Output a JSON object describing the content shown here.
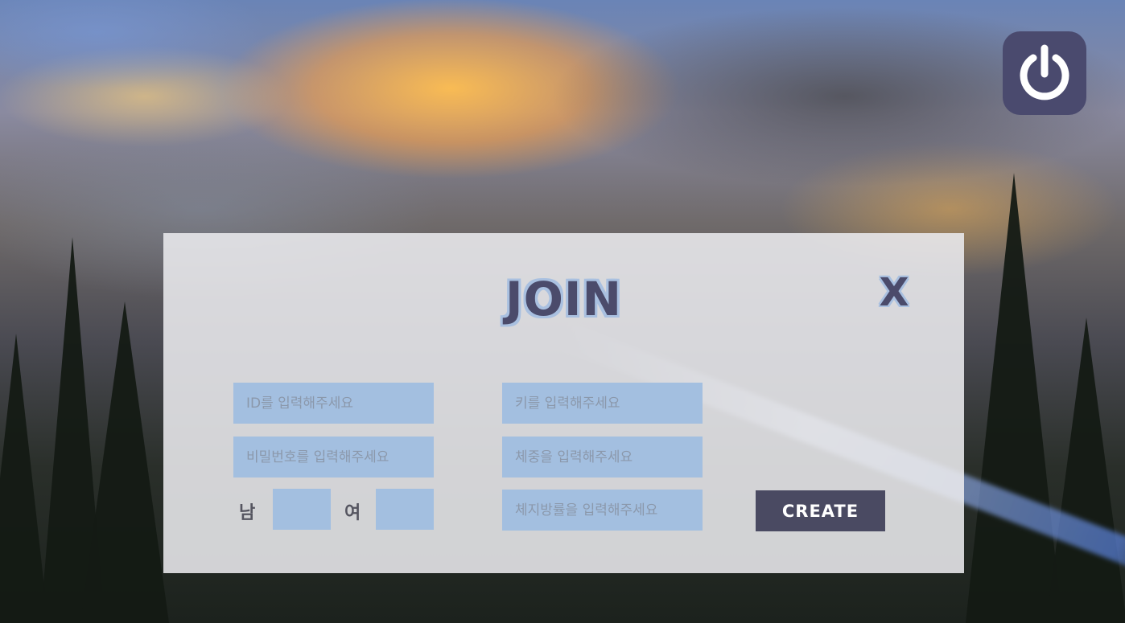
{
  "modal": {
    "title": "JOIN",
    "close_label": "X"
  },
  "form": {
    "id_placeholder": "ID를 입력해주세요",
    "password_placeholder": "비밀번호를 입력해주세요",
    "height_placeholder": "키를 입력해주세요",
    "weight_placeholder": "체중을 입력해주세요",
    "body_fat_placeholder": "체지방률을 입력해주세요",
    "gender_male_label": "남",
    "gender_female_label": "여",
    "create_label": "CREATE"
  },
  "icons": {
    "power": "power-icon"
  },
  "colors": {
    "accent": "#4a4a6e",
    "field": "#a3bfe0",
    "title_outline": "#a9c0e0",
    "button": "#4a4a62"
  }
}
